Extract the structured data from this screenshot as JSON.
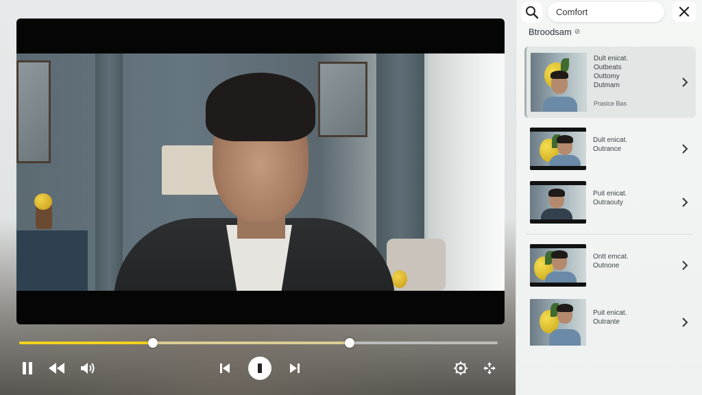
{
  "sidebar": {
    "search": {
      "value": "Comfort",
      "placeholder": ""
    },
    "section_title": "Btroodsam",
    "section_badge": "⊘",
    "items": [
      {
        "lines": [
          "Dult enicat.",
          "Outbeats",
          "Outtomy",
          "Dutmam"
        ],
        "sub": "Prasice Bas",
        "active": true
      },
      {
        "lines": [
          "Dult enicat.",
          "Outrance"
        ],
        "sub": "",
        "active": false
      },
      {
        "lines": [
          "Puit enicat.",
          "Outraouty"
        ],
        "sub": "",
        "active": false
      },
      {
        "lines": [
          "Ontt emcat.",
          "Outnone"
        ],
        "sub": "",
        "active": false
      },
      {
        "lines": [
          "Puit enicat.",
          "Outrante"
        ],
        "sub": "",
        "active": false
      }
    ]
  },
  "player": {
    "progress_played": 0.28,
    "progress_buffered": 0.69,
    "icons": {
      "pause": "pause-icon",
      "rewind": "rewind-icon",
      "volume": "volume-icon",
      "prev": "skip-previous-icon",
      "play": "play-pause-icon",
      "next": "skip-next-icon",
      "settings": "settings-icon",
      "fullscreen": "fullscreen-icon"
    }
  },
  "colors": {
    "accent": "#f3d21c",
    "video_bg": "#050505"
  }
}
